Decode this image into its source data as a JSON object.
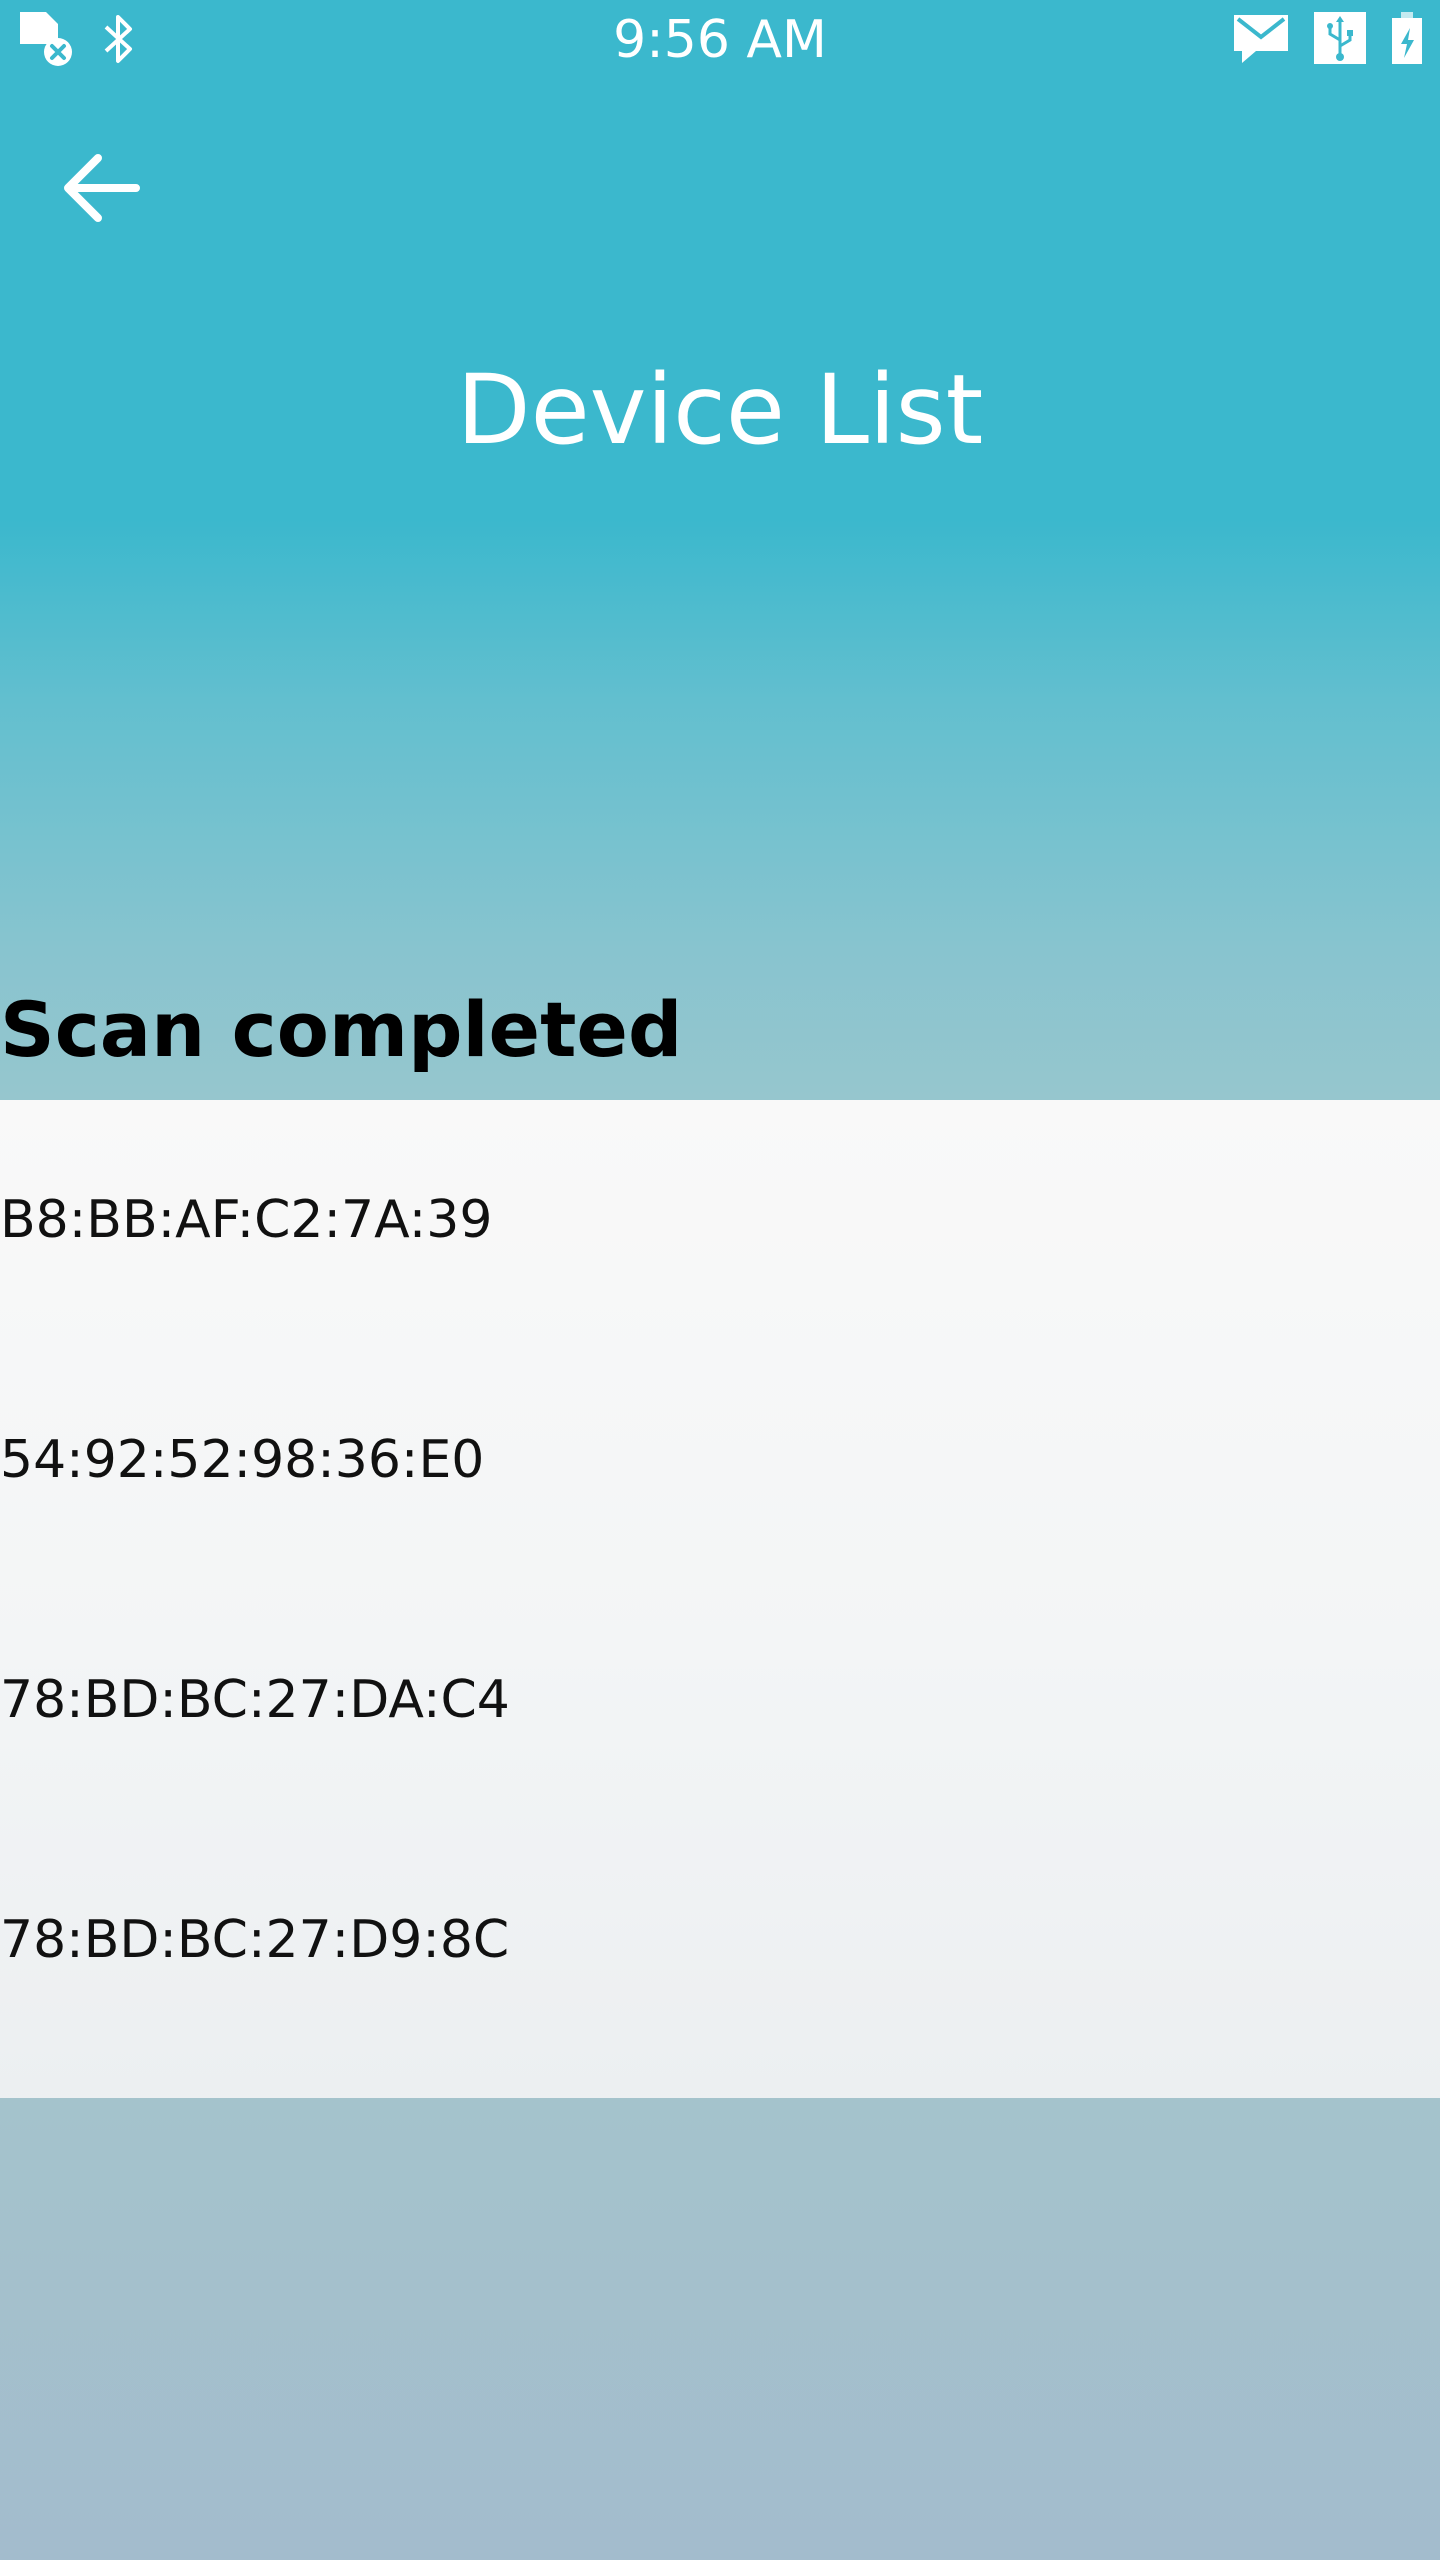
{
  "status_bar": {
    "time": "9:56 AM",
    "icons_left": [
      "sim-error-icon",
      "bluetooth-icon"
    ],
    "icons_right": [
      "mail-icon",
      "usb-icon",
      "battery-charging-icon"
    ]
  },
  "header": {
    "back_icon": "arrow-left-icon",
    "title": "Device List"
  },
  "scan_status": "Scan completed",
  "devices": [
    {
      "address": "B8:BB:AF:C2:7A:39"
    },
    {
      "address": "54:92:52:98:36:E0"
    },
    {
      "address": "78:BD:BC:27:DA:C4"
    },
    {
      "address": "78:BD:BC:27:D9:8C"
    }
  ],
  "colors": {
    "header_teal": "#3bb8cd",
    "bottom_gray_blue": "#a3bccd",
    "list_background": "#f5f6f7"
  }
}
